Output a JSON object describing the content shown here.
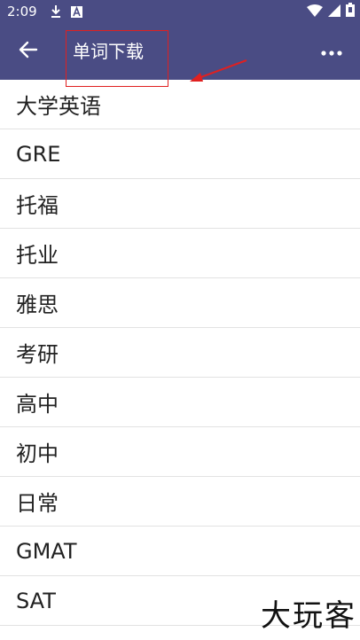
{
  "status_bar": {
    "time": "2:09",
    "icons": [
      "download-icon",
      "a-icon",
      "wifi-icon",
      "signal-icon",
      "battery-icon"
    ]
  },
  "app_bar": {
    "title": "单词下载",
    "back_icon": "arrow-left-icon",
    "more_icon": "more-horizontal-icon",
    "background_color": "#4a4c84"
  },
  "annotation": {
    "box_color": "#e02020",
    "arrow_color": "#e02020"
  },
  "list": {
    "items": [
      {
        "label": "大学英语"
      },
      {
        "label": "GRE"
      },
      {
        "label": "托福"
      },
      {
        "label": "托业"
      },
      {
        "label": "雅思"
      },
      {
        "label": "考研"
      },
      {
        "label": "高中"
      },
      {
        "label": "初中"
      },
      {
        "label": "日常"
      },
      {
        "label": "GMAT"
      },
      {
        "label": "SAT"
      }
    ]
  },
  "watermark": "大玩客"
}
